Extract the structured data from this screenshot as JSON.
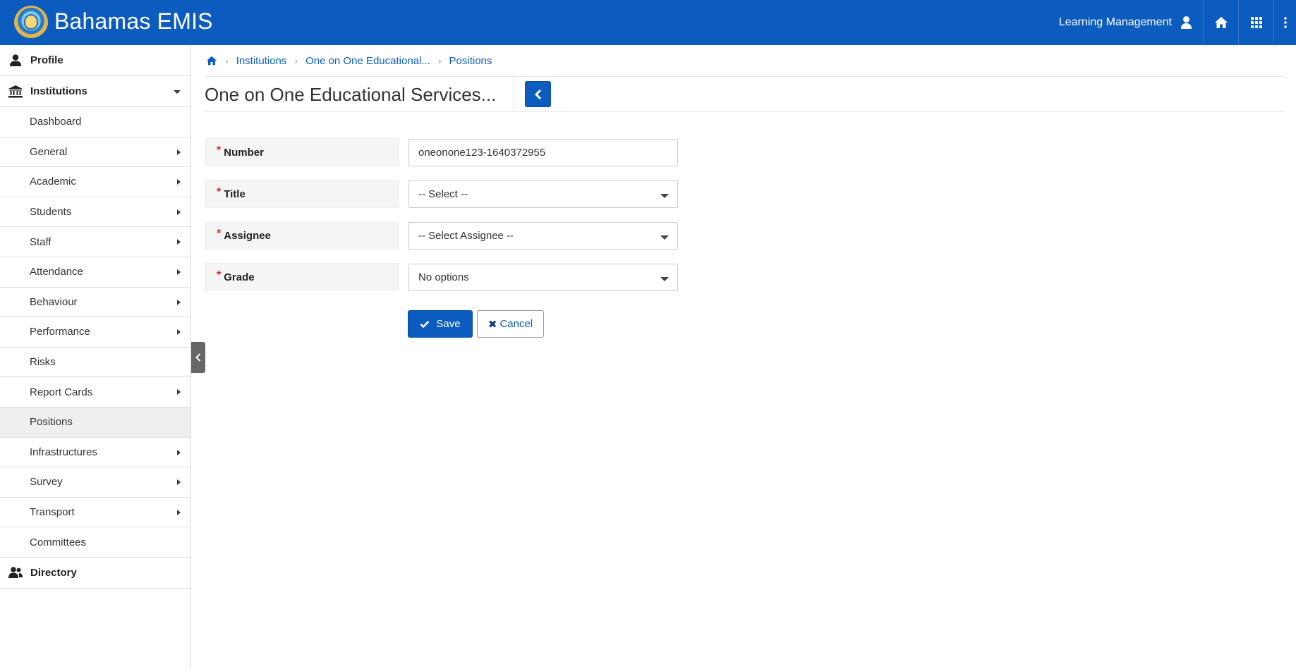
{
  "header": {
    "app_title": "Bahamas EMIS",
    "module": "Learning Management",
    "brand_color": "#0b5cbe"
  },
  "sidebar": {
    "profile": "Profile",
    "institutions": "Institutions",
    "items": [
      {
        "label": "Dashboard",
        "submenu": false
      },
      {
        "label": "General",
        "submenu": true
      },
      {
        "label": "Academic",
        "submenu": true
      },
      {
        "label": "Students",
        "submenu": true
      },
      {
        "label": "Staff",
        "submenu": true
      },
      {
        "label": "Attendance",
        "submenu": true
      },
      {
        "label": "Behaviour",
        "submenu": true
      },
      {
        "label": "Performance",
        "submenu": true
      },
      {
        "label": "Risks",
        "submenu": false
      },
      {
        "label": "Report Cards",
        "submenu": true
      },
      {
        "label": "Positions",
        "submenu": false,
        "active": true
      },
      {
        "label": "Infrastructures",
        "submenu": true
      },
      {
        "label": "Survey",
        "submenu": true
      },
      {
        "label": "Transport",
        "submenu": true
      },
      {
        "label": "Committees",
        "submenu": false
      }
    ],
    "directory": "Directory"
  },
  "breadcrumb": {
    "institutions": "Institutions",
    "institution": "One on One Educational...",
    "positions": "Positions"
  },
  "page_title": "One on One Educational Services...",
  "form": {
    "number_label": "Number",
    "number_value": "oneonone123-1640372955",
    "title_label": "Title",
    "title_value": "-- Select --",
    "assignee_label": "Assignee",
    "assignee_value": "-- Select Assignee --",
    "grade_label": "Grade",
    "grade_value": "No options",
    "save_label": "Save",
    "cancel_label": "Cancel"
  }
}
